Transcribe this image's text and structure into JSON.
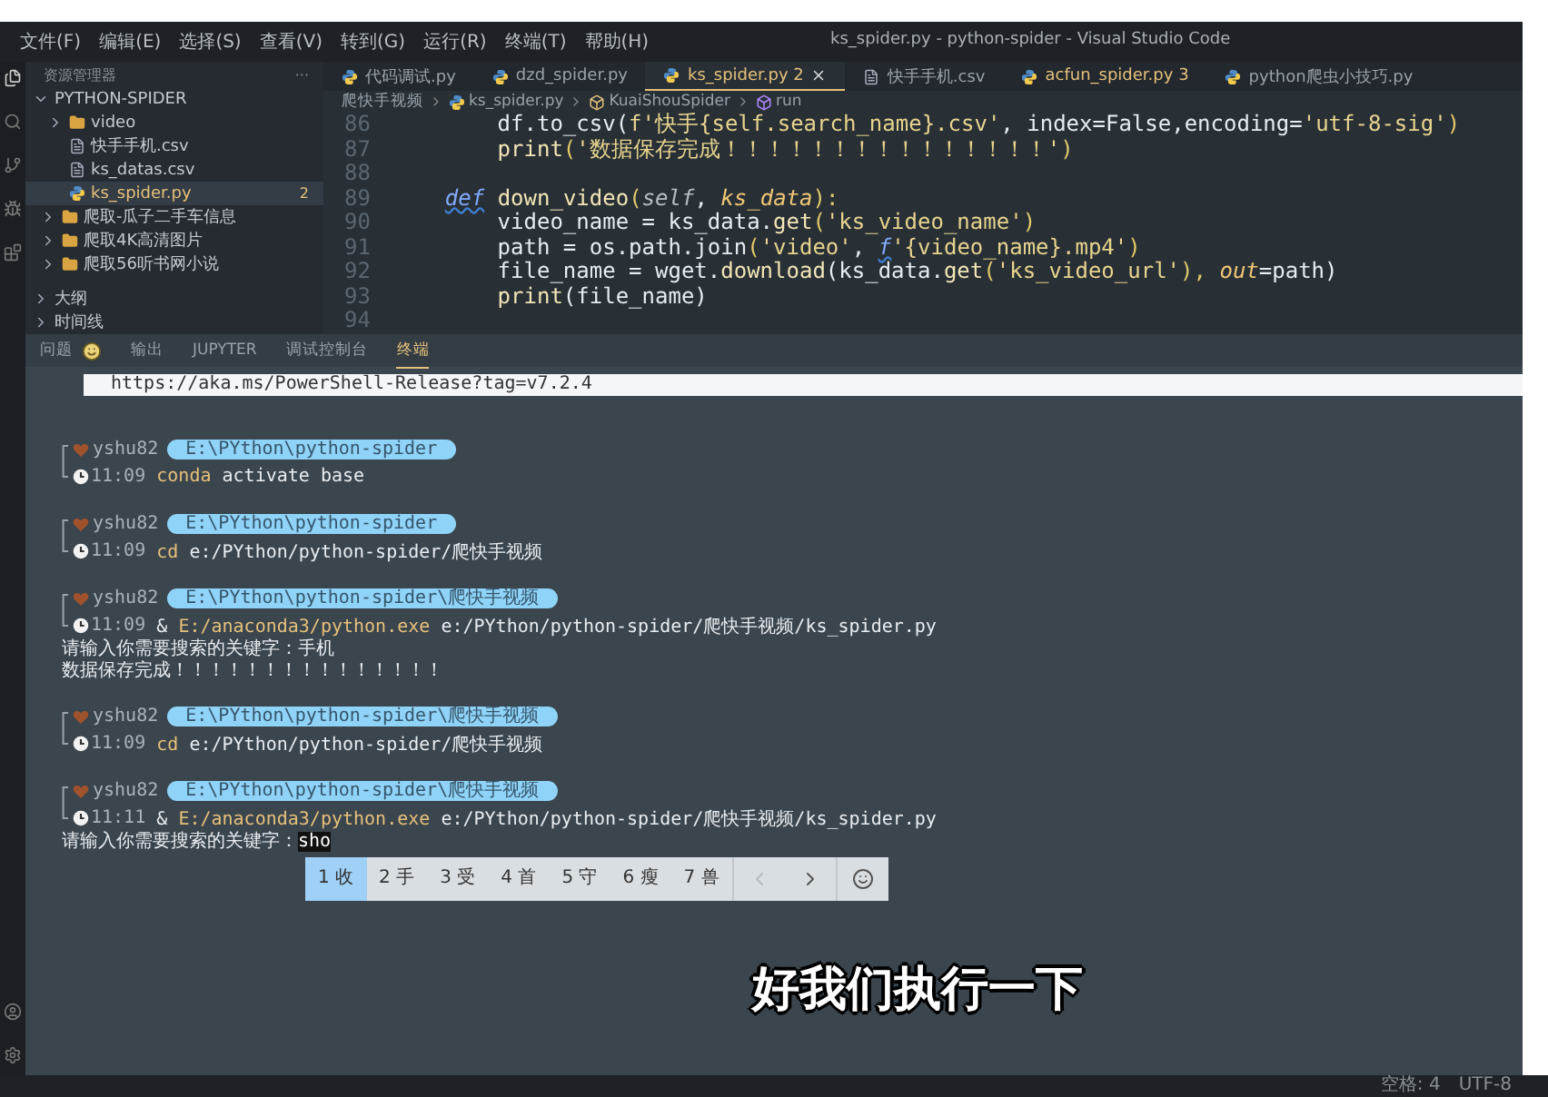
{
  "menu": [
    "文件(F)",
    "编辑(E)",
    "选择(S)",
    "查看(V)",
    "转到(G)",
    "运行(R)",
    "终端(T)",
    "帮助(H)"
  ],
  "window": {
    "title": "ks_spider.py - python-spider - Visual Studio Code"
  },
  "sidebar": {
    "header": "资源管理器",
    "more": "···",
    "section": "PYTHON-SPIDER",
    "items": [
      {
        "label": "video",
        "kind": "folder",
        "expanded": false,
        "selected": false
      },
      {
        "label": "快手手机.csv",
        "kind": "csv",
        "selected": false
      },
      {
        "label": "ks_datas.csv",
        "kind": "csv",
        "selected": false
      },
      {
        "label": "ks_spider.py",
        "kind": "python",
        "selected": true,
        "count": "2"
      },
      {
        "label": "爬取-瓜子二手车信息",
        "kind": "folder",
        "expanded": false,
        "selected": false
      },
      {
        "label": "爬取4K高清图片",
        "kind": "folder",
        "expanded": false,
        "selected": false
      },
      {
        "label": "爬取56听书网小说",
        "kind": "folder",
        "expanded": false,
        "selected": false
      }
    ],
    "sections": [
      {
        "label": "大纲",
        "expanded": false
      },
      {
        "label": "时间线",
        "expanded": false
      }
    ]
  },
  "tabs": [
    {
      "label": "代码调试.py",
      "kind": "python",
      "selected": false
    },
    {
      "label": "dzd_spider.py",
      "kind": "python",
      "selected": false
    },
    {
      "label": "ks_spider.py",
      "count": "2",
      "kind": "python",
      "selected": true
    },
    {
      "label": "快手手机.csv",
      "kind": "csv",
      "selected": false
    },
    {
      "label": "acfun_spider.py",
      "count": "3",
      "kind": "python",
      "selected": false
    },
    {
      "label": "python爬虫小技巧.py",
      "kind": "python",
      "selected": false
    }
  ],
  "breadcrumb": [
    {
      "label": "爬快手视频",
      "kind": "folder"
    },
    {
      "label": "ks_spider.py",
      "kind": "python"
    },
    {
      "label": "KuaiShouSpider",
      "kind": "class"
    },
    {
      "label": "run",
      "kind": "method"
    }
  ],
  "code": [
    {
      "number": "86",
      "tokens": [
        {
          "text": "        df.to_csv(",
          "kind": "plain"
        },
        {
          "text": "f'快手{self.search_name}.csv'",
          "kind": "str"
        },
        {
          "text": ", index=False,encoding=",
          "kind": "plain"
        },
        {
          "text": "'utf-8-sig'",
          "kind": "str"
        },
        {
          "text": ")",
          "kind": "punc"
        }
      ]
    },
    {
      "number": "87",
      "tokens": [
        {
          "text": "        print",
          "kind": "fn"
        },
        {
          "text": "(",
          "kind": "punc"
        },
        {
          "text": "'数据保存完成！！！！！！！！！！！！！！！'",
          "kind": "str"
        },
        {
          "text": ")",
          "kind": "punc"
        }
      ]
    },
    {
      "number": "88"
    },
    {
      "number": "89",
      "tokens": [
        {
          "text": "    def",
          "kind": "kw"
        },
        {
          "text": " down_video",
          "kind": "fn"
        },
        {
          "text": "(",
          "kind": "punc"
        },
        {
          "text": "self",
          "kind": "self"
        },
        {
          "text": ", ",
          "kind": "plain"
        },
        {
          "text": "ks_data",
          "kind": "param"
        },
        {
          "text": "):",
          "kind": "punc"
        }
      ]
    },
    {
      "number": "90",
      "tokens": [
        {
          "text": "        video_name = ks_data.",
          "kind": "plain"
        },
        {
          "text": "get",
          "kind": "fn"
        },
        {
          "text": "(",
          "kind": "punc"
        },
        {
          "text": "'ks_video_name'",
          "kind": "str"
        },
        {
          "text": ")",
          "kind": "punc"
        }
      ]
    },
    {
      "number": "91",
      "tokens": [
        {
          "text": "        path = os.path.join",
          "kind": "plain"
        },
        {
          "text": "(",
          "kind": "punc"
        },
        {
          "text": "'video'",
          "kind": "str"
        },
        {
          "text": ", ",
          "kind": "plain"
        },
        {
          "text": "f",
          "kind": "kw"
        },
        {
          "text": "'{video_name}.mp4'",
          "kind": "str"
        },
        {
          "text": ")",
          "kind": "punc"
        }
      ]
    },
    {
      "number": "92",
      "tokens": [
        {
          "text": "        file_name = wget.",
          "kind": "plain"
        },
        {
          "text": "download",
          "kind": "fn"
        },
        {
          "text": "(ks_data.",
          "kind": "plain"
        },
        {
          "text": "get",
          "kind": "fn"
        },
        {
          "text": "(",
          "kind": "punc"
        },
        {
          "text": "'ks_video_url'",
          "kind": "str"
        },
        {
          "text": "), ",
          "kind": "punc"
        },
        {
          "text": "out",
          "kind": "param"
        },
        {
          "text": "=path)",
          "kind": "plain"
        }
      ]
    },
    {
      "number": "93",
      "tokens": [
        {
          "text": "        print",
          "kind": "fn"
        },
        {
          "text": "(file_name)",
          "kind": "plain"
        }
      ]
    },
    {
      "number": "94"
    }
  ],
  "panel": {
    "tabs": [
      {
        "label": "问题",
        "selected": false,
        "badge": true
      },
      {
        "label": "输出",
        "selected": false
      },
      {
        "label": "JUPYTER",
        "selected": false
      },
      {
        "label": "调试控制台",
        "selected": false
      },
      {
        "label": "终端",
        "selected": true
      }
    ]
  },
  "terminal": {
    "banner": "https://aka.ms/PowerShell-Release?tag=v7.2.4",
    "blocks": [
      {
        "user": "yshu82",
        "path": "E:\\PYthon\\python-spider",
        "time": "11:09",
        "command": [
          {
            "text": "conda",
            "kind": "hl"
          },
          {
            "text": " activate base",
            "kind": "plain"
          }
        ]
      },
      {
        "user": "yshu82",
        "path": "E:\\PYthon\\python-spider",
        "time": "11:09",
        "command": [
          {
            "text": "cd",
            "kind": "hl"
          },
          {
            "text": " e:/PYthon/python-spider/爬快手视频",
            "kind": "plain"
          }
        ]
      },
      {
        "user": "yshu82",
        "path": "E:\\PYthon\\python-spider\\爬快手视频",
        "time": "11:09",
        "command": [
          {
            "text": "& ",
            "kind": "plain"
          },
          {
            "text": "E:/anaconda3/python.exe",
            "kind": "hl"
          },
          {
            "text": " e:/PYthon/python-spider/爬快手视频/ks_spider.py",
            "kind": "plain"
          }
        ],
        "output": [
          {
            "text": "请输入你需要搜索的关键字：手机"
          },
          {
            "text": "数据保存完成！！！！！！！！！！！！！！！"
          }
        ]
      },
      {
        "user": "yshu82",
        "path": "E:\\PYthon\\python-spider\\爬快手视频",
        "time": "11:09",
        "command": [
          {
            "text": "cd",
            "kind": "hl"
          },
          {
            "text": " e:/PYthon/python-spider/爬快手视频",
            "kind": "plain"
          }
        ]
      },
      {
        "user": "yshu82",
        "path": "E:\\PYthon\\python-spider\\爬快手视频",
        "time": "11:11",
        "command": [
          {
            "text": "& ",
            "kind": "plain"
          },
          {
            "text": "E:/anaconda3/python.exe",
            "kind": "hl"
          },
          {
            "text": " e:/PYthon/python-spider/爬快手视频/ks_spider.py",
            "kind": "plain"
          }
        ],
        "output": [
          {
            "text": "请输入你需要搜索的关键字：",
            "typed": "sho"
          }
        ]
      }
    ]
  },
  "ime": {
    "candidates": [
      {
        "number": "1",
        "char": "收",
        "selected": true
      },
      {
        "number": "2",
        "char": "手",
        "selected": false
      },
      {
        "number": "3",
        "char": "受",
        "selected": false
      },
      {
        "number": "4",
        "char": "首",
        "selected": false
      },
      {
        "number": "5",
        "char": "守",
        "selected": false
      },
      {
        "number": "6",
        "char": "瘦",
        "selected": false
      },
      {
        "number": "7",
        "char": "兽",
        "selected": false
      }
    ],
    "prev_disabled": true
  },
  "subtitle": "好我们执行一下",
  "status_bar": [
    "空格: 4",
    "UTF-8"
  ]
}
